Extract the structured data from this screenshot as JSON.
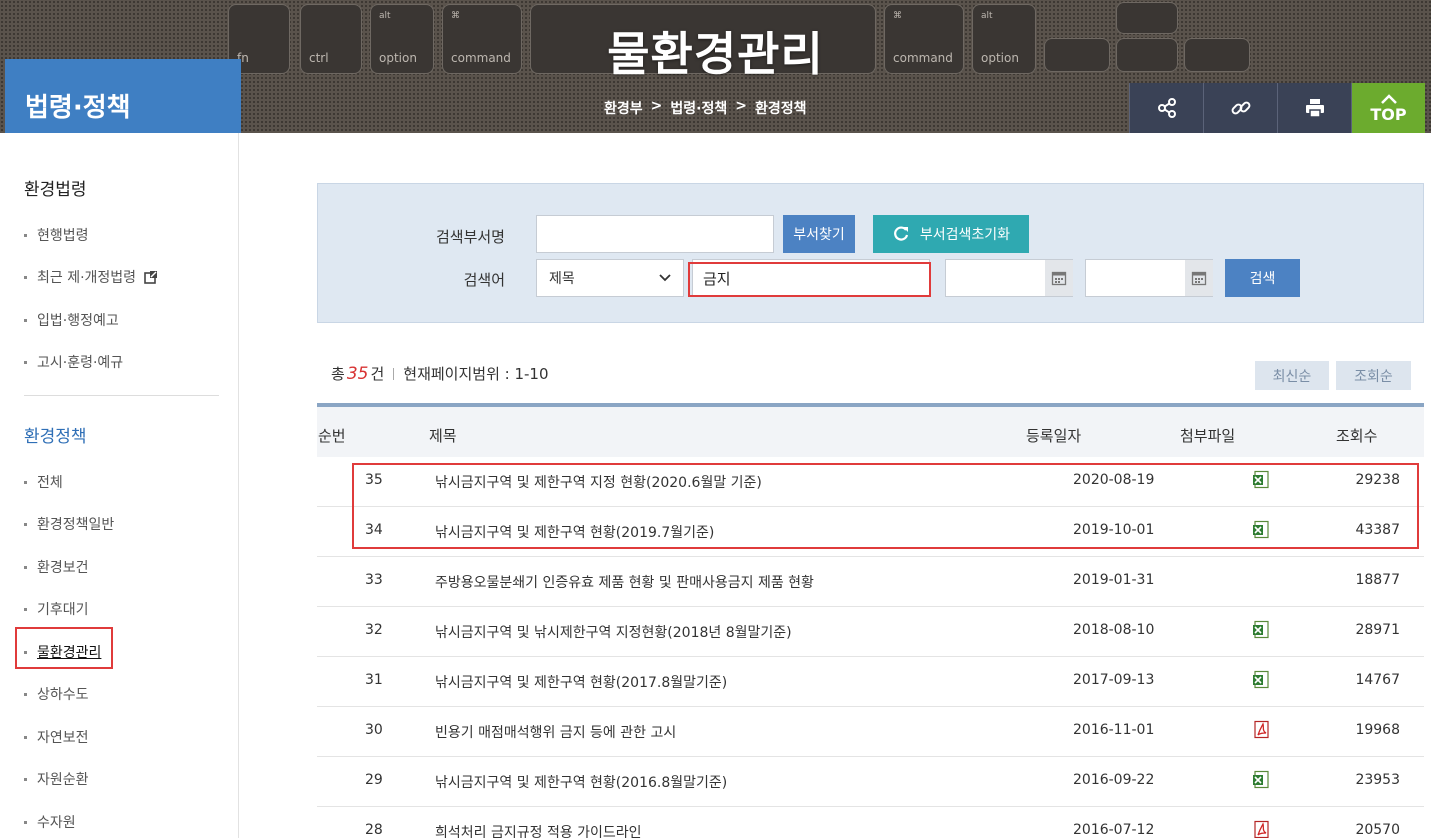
{
  "banner": {
    "title": "물환경관리",
    "keys": [
      {
        "label": "fn",
        "sym": ""
      },
      {
        "label": "ctrl",
        "sym": ""
      },
      {
        "label": "option",
        "sym": "alt"
      },
      {
        "label": "command",
        "sym": "⌘"
      },
      {
        "label": "",
        "sym": ""
      },
      {
        "label": "command",
        "sym": "⌘"
      },
      {
        "label": "option",
        "sym": "alt"
      }
    ],
    "breadcrumb": [
      "환경부",
      "법령·정책",
      "환경정책"
    ],
    "breadcrumb_sep": ">"
  },
  "section_title": "법령·정책",
  "toolbar": {
    "share_icon": "share-icon",
    "link_icon": "link-icon",
    "print_icon": "print-icon",
    "top_label": "TOP"
  },
  "sidebar": {
    "group1_title": "환경법령",
    "group1_items": [
      "현행법령",
      "최근 제·개정법령",
      "입법·행정예고",
      "고시·훈령·예규"
    ],
    "group2_title": "환경정책",
    "group2_items": [
      "전체",
      "환경정책일반",
      "환경보건",
      "기후대기",
      "물환경관리",
      "상하수도",
      "자연보전",
      "자원순환",
      "수자원"
    ],
    "active_item": "물환경관리"
  },
  "search": {
    "dept_label": "검색부서명",
    "dept_value": "",
    "find_dept_button": "부서찾기",
    "reset_button": "부서검색초기화",
    "keyword_label": "검색어",
    "field_select": "제목",
    "keyword_value": "금지",
    "start_date": "",
    "end_date": "",
    "search_button": "검색"
  },
  "summary": {
    "total_prefix": "총",
    "total_count": "35",
    "total_suffix": "건",
    "range_label": "현재페이지범위 : 1-10"
  },
  "sort": {
    "latest": "최신순",
    "views": "조회순"
  },
  "table": {
    "headers": {
      "num": "순번",
      "title": "제목",
      "date": "등록일자",
      "file": "첨부파일",
      "views": "조회수"
    },
    "rows": [
      {
        "num": "35",
        "title": "낚시금지구역 및 제한구역 지정 현황(2020.6월말 기준)",
        "date": "2020-08-19",
        "file": "excel",
        "views": "29238"
      },
      {
        "num": "34",
        "title": "낚시금지구역 및 제한구역 현황(2019.7월기준)",
        "date": "2019-10-01",
        "file": "excel",
        "views": "43387"
      },
      {
        "num": "33",
        "title": "주방용오물분쇄기 인증유효 제품 현황 및 판매사용금지 제품 현황",
        "date": "2019-01-31",
        "file": "",
        "views": "18877"
      },
      {
        "num": "32",
        "title": "낚시금지구역 및 낚시제한구역 지정현황(2018년 8월말기준)",
        "date": "2018-08-10",
        "file": "excel",
        "views": "28971"
      },
      {
        "num": "31",
        "title": "낚시금지구역 및 제한구역 현황(2017.8월말기준)",
        "date": "2017-09-13",
        "file": "excel",
        "views": "14767"
      },
      {
        "num": "30",
        "title": "빈용기 매점매석행위 금지 등에 관한 고시",
        "date": "2016-11-01",
        "file": "pdf",
        "views": "19968"
      },
      {
        "num": "29",
        "title": "낚시금지구역 및 제한구역 현황(2016.8월말기준)",
        "date": "2016-09-22",
        "file": "excel",
        "views": "23953"
      },
      {
        "num": "28",
        "title": "희석처리 금지규정 적용 가이드라인",
        "date": "2016-07-12",
        "file": "pdf",
        "views": "20570"
      }
    ]
  }
}
